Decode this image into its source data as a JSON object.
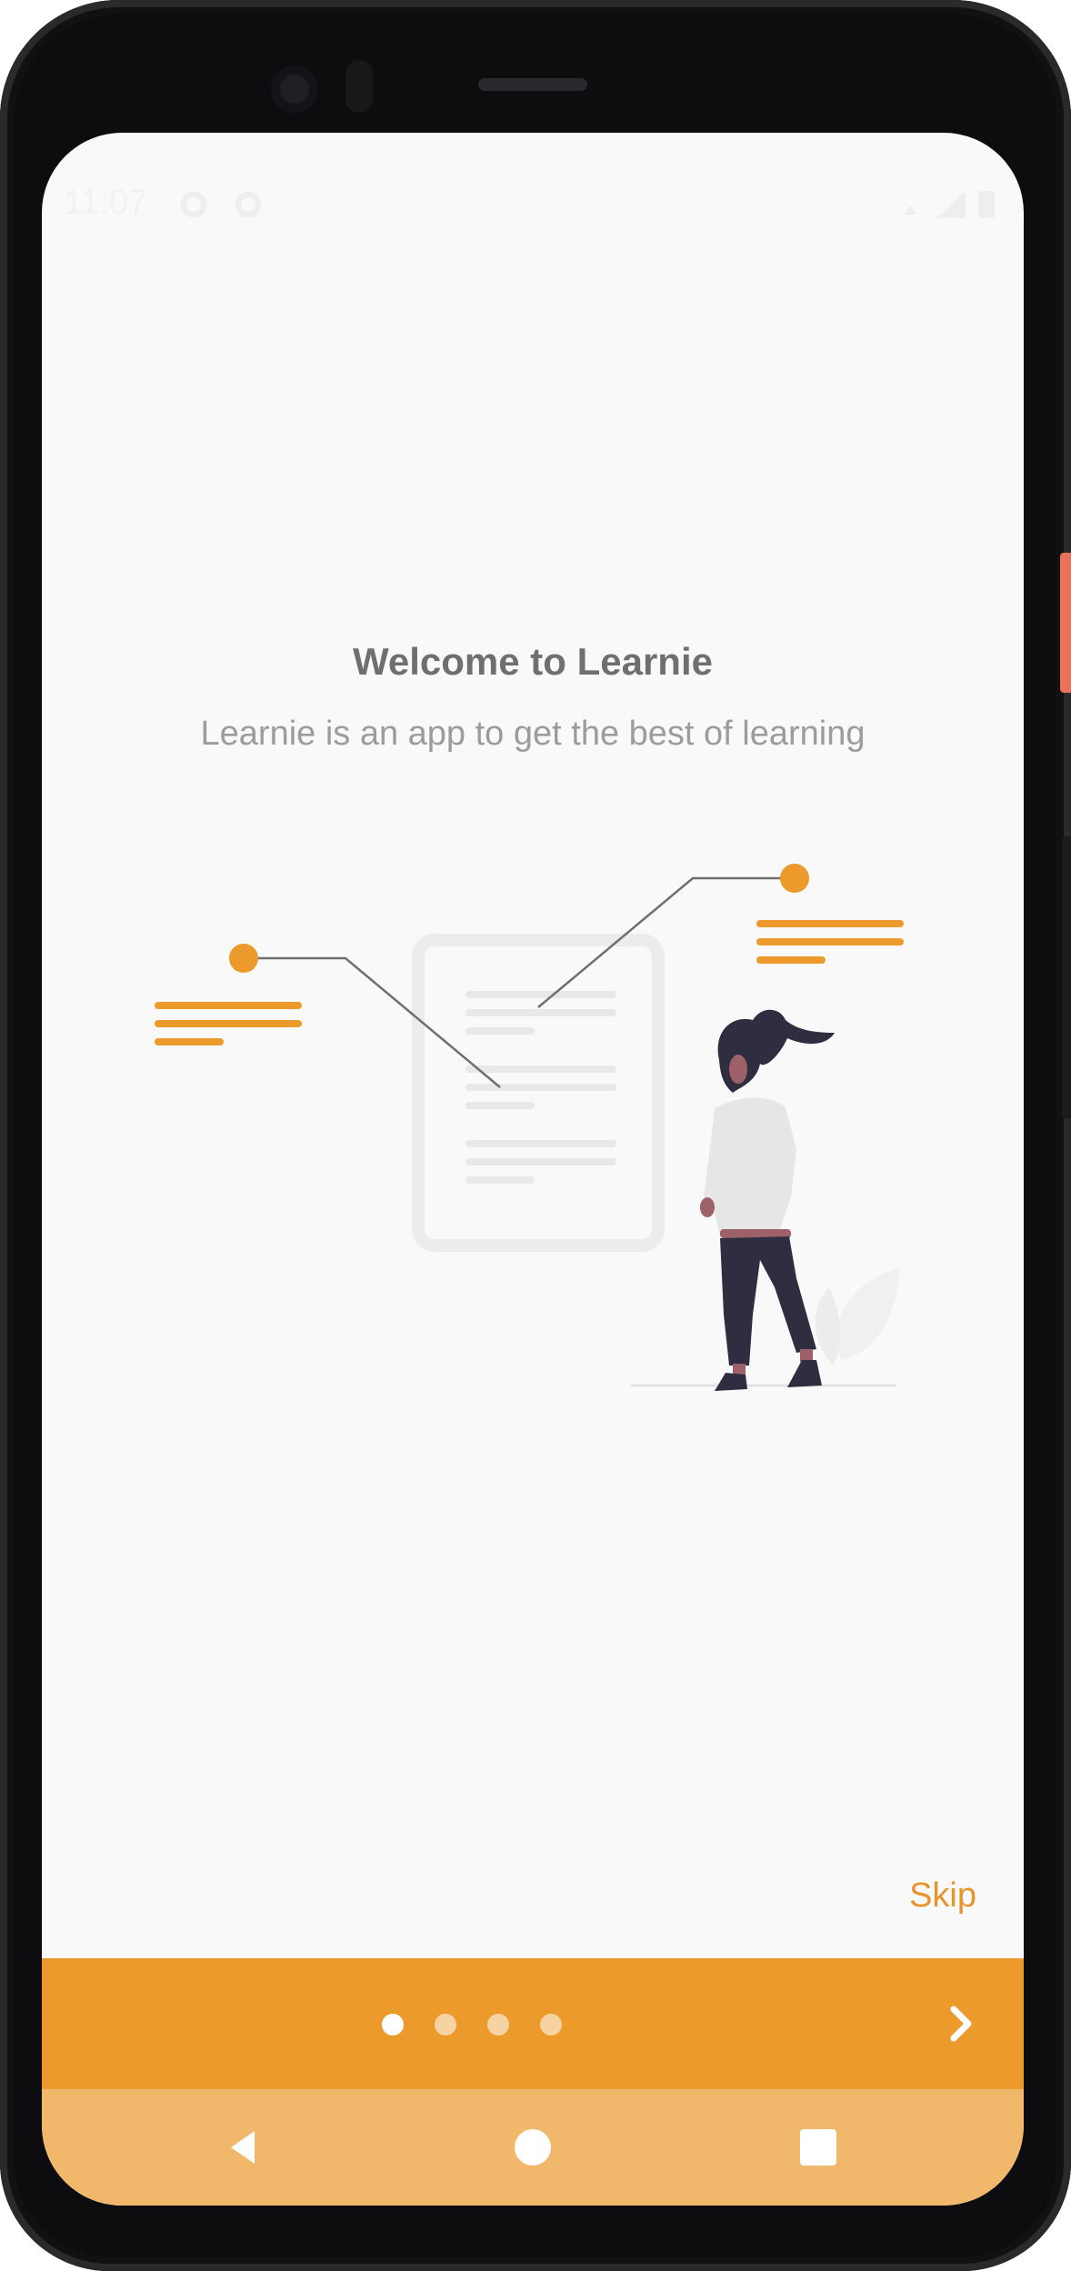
{
  "status_bar": {
    "time": "11:07",
    "icons": [
      "gear-icon",
      "gear-icon",
      "wifi-icon",
      "signal-icon",
      "battery-icon"
    ]
  },
  "onboarding": {
    "title": "Welcome to Learnie",
    "subtitle": "Learnie is an app to get the best of learning",
    "skip_label": "Skip",
    "page_indicator": {
      "total": 4,
      "active_index": 0
    },
    "next_icon": "chevron-right-icon"
  },
  "nav_bar": {
    "icons": [
      "back-icon",
      "home-icon",
      "recents-icon"
    ]
  },
  "colors": {
    "accent": "#EC9A2C",
    "nav_background": "#F1B76B",
    "screen_background": "#F9F9F9",
    "title_text": "#6F6F72",
    "subtitle_text": "#9C9C9F",
    "figure_dark": "#2F2E41",
    "figure_light": "#E6E6E6"
  }
}
